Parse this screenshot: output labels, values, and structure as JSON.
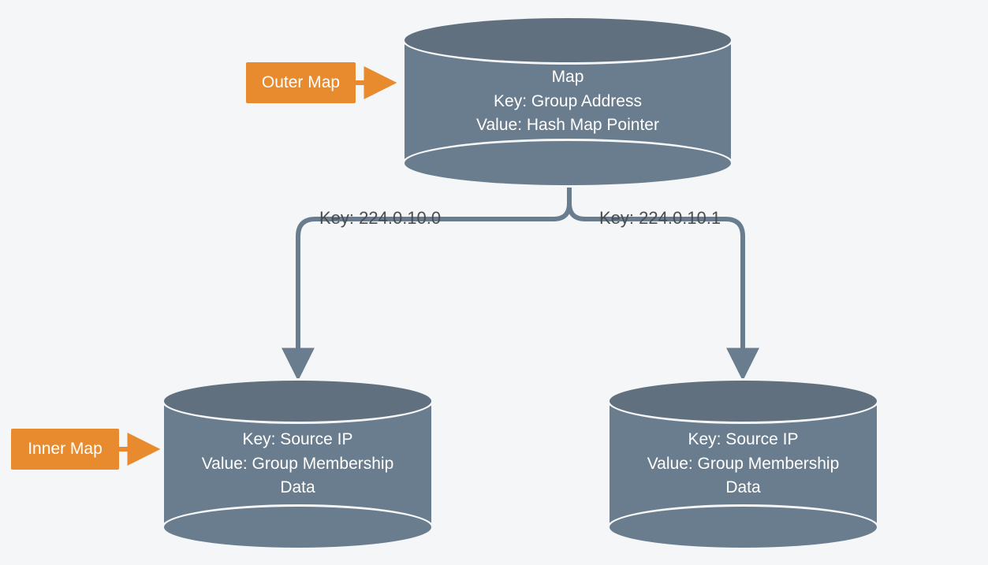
{
  "tags": {
    "outer": "Outer Map",
    "inner": "Inner Map"
  },
  "outer_cylinder": {
    "line1": "Map",
    "line2": "Key: Group Address",
    "line3": "Value: Hash Map Pointer"
  },
  "branch_keys": {
    "left": "Key: 224.0.10.0",
    "right": "Key: 224.0.10.1"
  },
  "inner_cylinder_left": {
    "line1": "Key: Source IP",
    "line2": "Value: Group Membership",
    "line3": "Data"
  },
  "inner_cylinder_right": {
    "line1": "Key: Source IP",
    "line2": "Value: Group Membership",
    "line3": "Data"
  },
  "colors": {
    "cylinder": "#6a7d8e",
    "cylinder_top": "#60707e",
    "tag": "#e88b2e",
    "text_dark": "#4a4c4e",
    "bg": "#f5f6f7"
  }
}
